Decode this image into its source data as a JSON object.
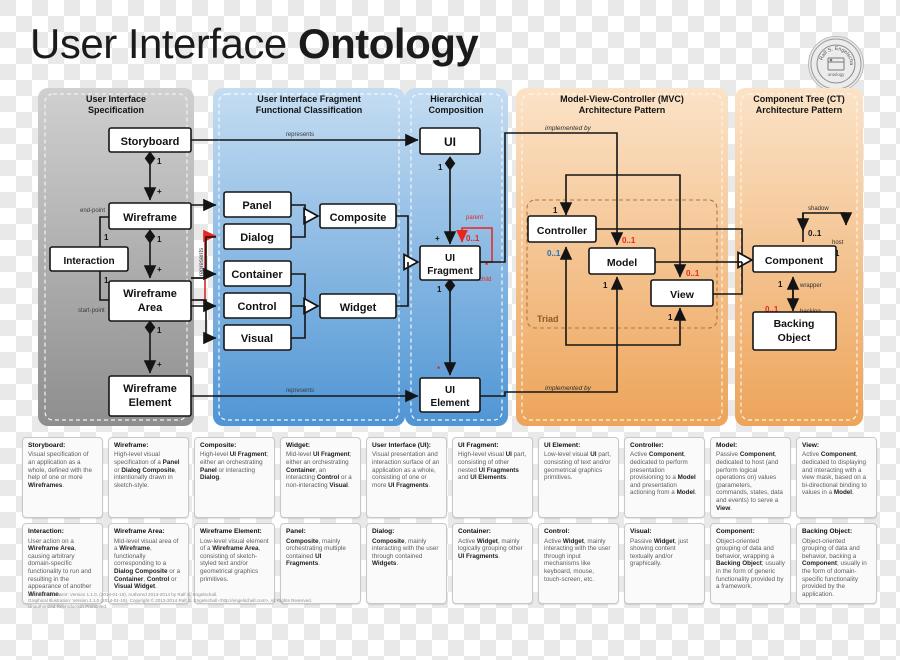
{
  "title": {
    "light": "User Interface ",
    "bold": "Ontology"
  },
  "logo": {
    "line1": "Ralf S. Engelschall",
    "line2": "ontology"
  },
  "panels": [
    {
      "id": "uis",
      "title_line1": "User Interface",
      "title_line2": "Specification"
    },
    {
      "id": "uifc",
      "title_line1": "User Interface Fragment",
      "title_line2": "Functional Classification"
    },
    {
      "id": "hc",
      "title_line1": "Hierarchical",
      "title_line2": "Composition"
    },
    {
      "id": "mvc",
      "title_line1": "Model-View-Controller (MVC)",
      "title_line2": "Architecture Pattern"
    },
    {
      "id": "ct",
      "title_line1": "Component Tree (CT)",
      "title_line2": "Architecture Pattern"
    }
  ],
  "nodes": {
    "storyboard": "Storyboard",
    "wireframe": "Wireframe",
    "interaction": "Interaction",
    "wireframe_area_l1": "Wireframe",
    "wireframe_area_l2": "Area",
    "wireframe_element_l1": "Wireframe",
    "wireframe_element_l2": "Element",
    "panel": "Panel",
    "dialog": "Dialog",
    "container": "Container",
    "control": "Control",
    "visual": "Visual",
    "composite": "Composite",
    "widget": "Widget",
    "ui": "UI",
    "ui_fragment_l1": "UI",
    "ui_fragment_l2": "Fragment",
    "ui_element_l1": "UI",
    "ui_element_l2": "Element",
    "controller": "Controller",
    "model": "Model",
    "view": "View",
    "component": "Component",
    "backing_object_l1": "Backing",
    "backing_object_l2": "Object",
    "triad": "Triad"
  },
  "edge_labels": {
    "represents_storyboard": "represents",
    "represents_wireframe": "represents",
    "represents_element": "represents",
    "end_point": "end-point",
    "start_point": "start-point",
    "parent": "parent",
    "child": "child",
    "implemented_by_top": "implemented by",
    "implemented_by_bottom": "implemented by",
    "shadow": "shadow",
    "host": "host",
    "wrapper": "wrapper",
    "backing": "backing"
  },
  "multiplicities": {
    "storyboard_wireframe_src": "1",
    "storyboard_wireframe_dst": "+",
    "wireframe_area_src": "1",
    "wireframe_area_dst": "+",
    "area_element_src": "1",
    "area_element_dst": "+",
    "interaction_end": "1",
    "interaction_end_near": "1",
    "interaction_start": "1",
    "interaction_start_near": "1",
    "ui_fragment_src": "1",
    "ui_fragment_dst": "+",
    "fragment_parent": "0..1",
    "fragment_child": "*",
    "fragment_element_src": "1",
    "fragment_element_dst": "*",
    "controller_in": "1",
    "controller_out": "0..1",
    "model_in": "0..1",
    "model_out": "1",
    "view_in": "0..1",
    "view_out": "1",
    "component_shadow": "0..1",
    "component_host": "0..1",
    "wrapper_mult": "1",
    "backing_mult": "0..1"
  },
  "colors": {
    "panel_gray": "#9a9a9a",
    "panel_blue": "#6aa9dd",
    "panel_orange": "#f0a95c",
    "red": "#e8251f",
    "blue": "#1b6fc4",
    "stroke": "#1a1a1a"
  },
  "legend": {
    "row1": [
      {
        "term": "Storyboard:",
        "def": "Visual specification of an application as a whole, defined with the help of one or more <b>Wireframes</b>."
      },
      {
        "term": "Wireframe:",
        "def": "High-level visual specification of a <b>Panel</b> or <b>Dialog Composite</b>, intentionally drawn in sketch-style."
      },
      {
        "term": "Composite:",
        "def": "High-level <b>UI Fragment</b>; either an orchestrating <b>Panel</b> or interacting <b>Dialog</b>."
      },
      {
        "term": "Widget:",
        "def": "Mid-level <b>UI Fragment</b>; either an orchestrating <b>Container</b>, an interacting <b>Control</b> or a non-interacting <b>Visual</b>."
      },
      {
        "term": "User Interface (UI):",
        "def": "Visual presentation and interaction surface of an application as a whole, consisting of one or more <b>UI Fragments</b>."
      },
      {
        "term": "UI Fragment:",
        "def": "High-level visual <b>UI</b> part, consisting of other nested <b>UI Fragments</b> and <b>UI Elements</b>."
      },
      {
        "term": "UI Element:",
        "def": "Low-level visual <b>UI</b> part, consisting of text and/or geometrical graphics primitives."
      },
      {
        "term": "Controller:",
        "def": "Active <b>Component</b>, dedicated to perform presentation provisioning to a <b>Model</b> and presentation actioning from a <b>Model</b>."
      },
      {
        "term": "Model:",
        "def": "Passive <b>Component</b>, dedicated to host (and perform logical operations on) values (parameters, commands, states, data and events) to serve a <b>View</b>."
      },
      {
        "term": "View:",
        "def": "Active <b>Component</b>, dedicated to displaying and interacting with a view mask, based on a bi-directional binding to values in a <b>Model</b>."
      }
    ],
    "row2": [
      {
        "term": "Interaction:",
        "def": "User action on a <b>Wireframe Area</b>, causing arbitrary domain-specific functionality to run and resulting in the appearance of another <b>Wireframe</b>."
      },
      {
        "term": "Wireframe Area:",
        "def": "Mid-level visual area of a <b>Wireframe</b>, functionally corresponding to a <b>Dialog Composite</b> or a <b>Container</b>, <b>Control</b> or <b>Visual Widget</b>."
      },
      {
        "term": "Wireframe Element:",
        "def": "Low-level visual element of a <b>Wireframe Area</b>, consisting of sketch-styled text and/or geometrical graphics primitives."
      },
      {
        "term": "Panel:",
        "def": "<b>Composite</b>, mainly orchestrating multiple contained <b>UI Fragments</b>."
      },
      {
        "term": "Dialog:",
        "def": "<b>Composite</b>, mainly interacting with the user through contained <b>Widgets</b>."
      },
      {
        "term": "Container:",
        "def": "Active <b>Widget</b>, mainly logically grouping other <b>UI Fragments</b>."
      },
      {
        "term": "Control:",
        "def": "Active <b>Widget</b>, mainly interacting with the user through input mechanisms like keyboard, mouse, touch-screen, etc."
      },
      {
        "term": "Visual:",
        "def": "Passive <b>Widget</b>, just showing content textually and/or graphically."
      },
      {
        "term": "Component:",
        "def": "Object-oriented grouping of data and behavior, wrapping a <b>Backing Object</b>; usually in the form of generic functionality provided by a framework."
      },
      {
        "term": "Backing Object:",
        "def": "Object-oriented grouping of data and behavior, backing a <b>Component</b>; usually in the form of domain-specific functionality provided by the application."
      }
    ]
  },
  "footer": {
    "line1": "Intellectual Content: Version 1.1.0, (2014-01-19), Authored 2013-2014 by Ralf S. Engelschall.",
    "line2": "Graphical Illustration: Version 1.1.0 (2014-01-19), Copyright © 2013-2014 Ralf S. Engelschall <http://engelschall.com>, All Rights Reserved.",
    "line3": "Unauthorized Reproduction Prohibited."
  }
}
